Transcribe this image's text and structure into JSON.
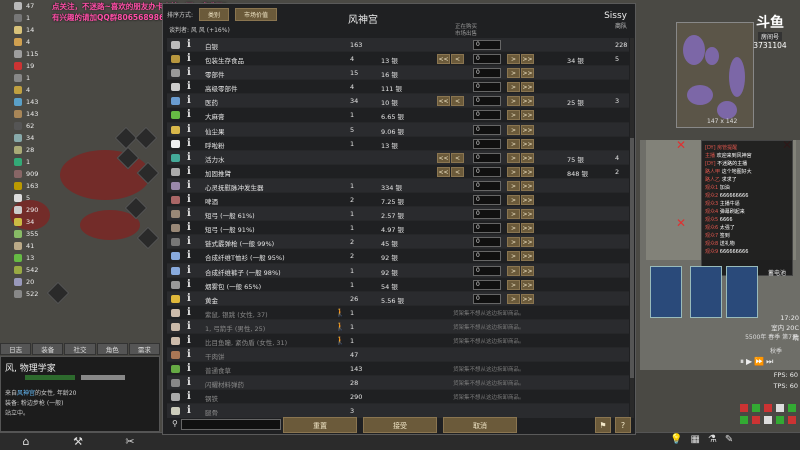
{
  "resources": [
    {
      "count": "47",
      "color": "#b9b9b9"
    },
    {
      "count": "1",
      "color": "#777777"
    },
    {
      "count": "14",
      "color": "#d8c27a"
    },
    {
      "count": "4",
      "color": "#d0a050"
    },
    {
      "count": "115",
      "color": "#9e9e9e"
    },
    {
      "count": "19",
      "color": "#c33"
    },
    {
      "count": "1",
      "color": "#888"
    },
    {
      "count": "4",
      "color": "#c0a040"
    },
    {
      "count": "143",
      "color": "#5aa0c8"
    },
    {
      "count": "143",
      "color": "#a88658"
    },
    {
      "count": "62",
      "color": "#555"
    },
    {
      "count": "34",
      "color": "#8aa"
    },
    {
      "count": "28",
      "color": "#aa7"
    },
    {
      "count": "1",
      "color": "#3a7"
    },
    {
      "count": "909",
      "color": "#866"
    },
    {
      "count": "163",
      "color": "#b90"
    },
    {
      "count": "5",
      "color": "#ddd"
    },
    {
      "count": "290",
      "color": "#ccc"
    },
    {
      "count": "34",
      "color": "#cb4"
    },
    {
      "count": "355",
      "color": "#8b6"
    },
    {
      "count": "41",
      "color": "#ba8"
    },
    {
      "count": "13",
      "color": "#6b4"
    },
    {
      "count": "542",
      "color": "#9a4"
    },
    {
      "count": "20",
      "color": "#99b"
    },
    {
      "count": "522",
      "color": "#888"
    }
  ],
  "stream_overlay": {
    "line1": "点关注，不迷路~喜欢的朋友办卡支持一下，求求了!",
    "line2": "有兴趣的请加QQ群806568986"
  },
  "left_tabs": [
    "日志",
    "装备",
    "社交",
    "角色",
    "需求"
  ],
  "pawn": {
    "name": "风, 物理学家",
    "line1_prefix": "来自",
    "line1_faction": "风神宫",
    "line1_suffix": "的女性, 年龄20",
    "line2": "装备: 粉边步枪 (一般)",
    "line3": "站立中。"
  },
  "dialog": {
    "tab1_label": "排序方式:",
    "tab1": "类别",
    "tab2": "市场价值",
    "title": "风神宫",
    "trader_name": "Sissy",
    "trader_type": "商队",
    "negotiator": "谈判者: 风 风 (+16%)",
    "header_hint1": "正在购买",
    "header_hint2": "市场出售"
  },
  "trade_rows": [
    {
      "name": "白银",
      "qty": "163",
      "price": "",
      "trader_qty": "228",
      "num": "0",
      "left": false,
      "right": false,
      "color": "#bbb",
      "note": ""
    },
    {
      "name": "包装生存食品",
      "qty": "4",
      "price": "13 银",
      "trader_qty": "5",
      "trader_price": "34 银",
      "num": "0",
      "left": true,
      "right": true,
      "color": "#b8973e"
    },
    {
      "name": "零部件",
      "qty": "15",
      "price": "16 银",
      "num": "0",
      "left": false,
      "right": true,
      "color": "#999"
    },
    {
      "name": "高级零部件",
      "qty": "4",
      "price": "111 银",
      "num": "0",
      "left": false,
      "right": true,
      "color": "#ccc"
    },
    {
      "name": "医药",
      "qty": "34",
      "price": "10 银",
      "trader_qty": "3",
      "trader_price": "25 银",
      "num": "0",
      "left": true,
      "right": true,
      "color": "#6a9cd0"
    },
    {
      "name": "大麻膏",
      "qty": "1",
      "price": "6.65 银",
      "num": "0",
      "left": false,
      "right": true,
      "color": "#6b4"
    },
    {
      "name": "仙尘果",
      "qty": "5",
      "price": "9.06 银",
      "num": "0",
      "left": false,
      "right": true,
      "color": "#d9b84a"
    },
    {
      "name": "呼啦粉",
      "qty": "1",
      "price": "13 银",
      "num": "0",
      "left": false,
      "right": true,
      "color": "#eee"
    },
    {
      "name": "活力水",
      "qty": "",
      "price": "",
      "trader_qty": "4",
      "trader_price": "75 银",
      "num": "0",
      "left": true,
      "right": true,
      "color": "#4a9"
    },
    {
      "name": "加固推臂",
      "qty": "",
      "price": "",
      "trader_qty": "2",
      "trader_price": "848 银",
      "num": "0",
      "left": true,
      "right": true,
      "color": "#aaa"
    },
    {
      "name": "心灵抚慰脉冲发生器",
      "qty": "1",
      "price": "334 银",
      "num": "0",
      "left": false,
      "right": true,
      "color": "#98a"
    },
    {
      "name": "啤酒",
      "qty": "2",
      "price": "7.25 银",
      "num": "0",
      "left": false,
      "right": true,
      "color": "#a66"
    },
    {
      "name": "短弓 (一般 61%)",
      "qty": "1",
      "price": "2.57 银",
      "num": "0",
      "left": false,
      "right": true,
      "color": "#987"
    },
    {
      "name": "短弓 (一般 91%)",
      "qty": "1",
      "price": "4.97 银",
      "num": "0",
      "left": false,
      "right": true,
      "color": "#987"
    },
    {
      "name": "链式霰弹枪 (一般 99%)",
      "qty": "2",
      "price": "45 银",
      "num": "0",
      "left": false,
      "right": true,
      "color": "#777"
    },
    {
      "name": "合成纤维T恤衫 (一般 95%)",
      "qty": "2",
      "price": "92 银",
      "num": "0",
      "left": false,
      "right": true,
      "color": "#8ad"
    },
    {
      "name": "合成纤维裤子 (一般 98%)",
      "qty": "1",
      "price": "92 银",
      "num": "0",
      "left": false,
      "right": true,
      "color": "#8ad"
    },
    {
      "name": "烟雾包 (一般 65%)",
      "qty": "1",
      "price": "54 银",
      "num": "0",
      "left": false,
      "right": true,
      "color": "#999"
    },
    {
      "name": "黄金",
      "qty": "26",
      "price": "5.56 银",
      "num": "0",
      "left": false,
      "right": true,
      "color": "#e0b83a"
    },
    {
      "name": "紫鼠, 银跳 (女性, 37)",
      "qty": "1",
      "price": "",
      "pawn": true,
      "dim": true,
      "note": "货架集不想从这边拆卸商品。",
      "color": "#cba"
    },
    {
      "name": "1, 弓箭手 (男性, 25)",
      "qty": "1",
      "price": "",
      "pawn": true,
      "dim": true,
      "note": "货架集不想从这边拆卸商品。",
      "color": "#cba"
    },
    {
      "name": "比目鱼瞳, 紧伪盾 (女性, 31)",
      "qty": "1",
      "price": "",
      "pawn": true,
      "dim": true,
      "note": "货架集不想从这边拆卸商品。",
      "color": "#cba"
    },
    {
      "name": "干肉饼",
      "qty": "47",
      "price": "",
      "dim": true,
      "note": "",
      "color": "#a75"
    },
    {
      "name": "普通食草",
      "qty": "143",
      "price": "",
      "dim": true,
      "note": "货架集不想从这边拆卸商品。",
      "color": "#6a4"
    },
    {
      "name": "闪耀材料弹药",
      "qty": "28",
      "price": "",
      "dim": true,
      "note": "货架集不想从这边拆卸商品。",
      "color": "#888"
    },
    {
      "name": "钢铁",
      "qty": "290",
      "price": "",
      "dim": true,
      "note": "货架集不想从这边拆卸商品。",
      "color": "#aaa"
    },
    {
      "name": "腿骨",
      "qty": "3",
      "price": "",
      "dim": true,
      "note": "",
      "color": "#ccb"
    }
  ],
  "footer": {
    "search_placeholder": "",
    "reset": "重置",
    "accept": "接受",
    "cancel": "取消"
  },
  "douyu": {
    "logo": "斗鱼",
    "room": "房间号",
    "number": "3731104"
  },
  "minimap": {
    "coords": "147 x 142"
  },
  "chat": [
    {
      "user": "[DY] 房管提醒",
      "msg": ""
    },
    {
      "user": "主播",
      "msg": "欢迎来到风神宫"
    },
    {
      "user": "[DY]",
      "msg": "不迷路的主播"
    },
    {
      "user": "路人甲",
      "msg": "这个地图好大"
    },
    {
      "user": "路人乙",
      "msg": "求求了"
    },
    {
      "user": "观众1",
      "msg": "加油"
    },
    {
      "user": "观众2",
      "msg": "666666666"
    },
    {
      "user": "观众3",
      "msg": "主播牛逼"
    },
    {
      "user": "观众4",
      "msg": "弹幕刷起来"
    },
    {
      "user": "观众5",
      "msg": "6666"
    },
    {
      "user": "观众6",
      "msg": "太强了"
    },
    {
      "user": "观众7",
      "msg": "签到"
    },
    {
      "user": "观众8",
      "msg": "送礼物"
    },
    {
      "user": "观众9",
      "msg": "666666666"
    }
  ],
  "battery_label": "蓄电池",
  "clock": {
    "time": "17:20",
    "temp": "室内 20C",
    "weather": "晴",
    "date": "5500年 春季 第7天",
    "season": "秋季"
  },
  "fps": {
    "fps": "FPS: 60",
    "tps": "TPS: 60"
  }
}
